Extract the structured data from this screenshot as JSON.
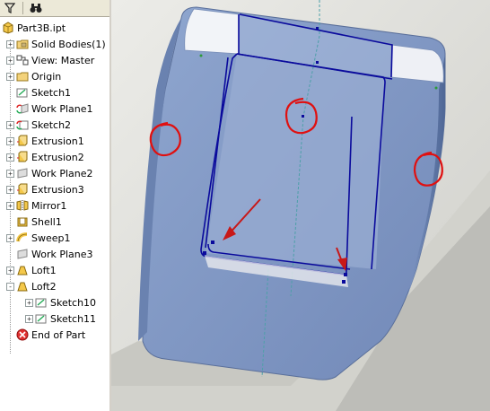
{
  "browser": {
    "toolbar": {
      "filter_icon": "filter-icon",
      "find_icon": "binoculars-icon"
    },
    "root": {
      "label": "Part3B.ipt",
      "icon": "part-icon"
    },
    "items": [
      {
        "label": "Solid Bodies(1)",
        "icon": "folder-solid-icon",
        "expander": "+",
        "indent": 1
      },
      {
        "label": "View: Master",
        "icon": "view-icon",
        "expander": "+",
        "indent": 1
      },
      {
        "label": "Origin",
        "icon": "folder-icon",
        "expander": "+",
        "indent": 1
      },
      {
        "label": "Sketch1",
        "icon": "sketch-icon",
        "expander": "",
        "indent": 1
      },
      {
        "label": "Work Plane1",
        "icon": "workplane-shared-icon",
        "expander": "",
        "indent": 1
      },
      {
        "label": "Sketch2",
        "icon": "sketch-shared-icon",
        "expander": "+",
        "indent": 1
      },
      {
        "label": "Extrusion1",
        "icon": "extrusion-icon",
        "expander": "+",
        "indent": 1
      },
      {
        "label": "Extrusion2",
        "icon": "extrusion-icon",
        "expander": "+",
        "indent": 1
      },
      {
        "label": "Work Plane2",
        "icon": "workplane-icon",
        "expander": "+",
        "indent": 1
      },
      {
        "label": "Extrusion3",
        "icon": "extrusion-icon",
        "expander": "+",
        "indent": 1
      },
      {
        "label": "Mirror1",
        "icon": "mirror-icon",
        "expander": "+",
        "indent": 1
      },
      {
        "label": "Shell1",
        "icon": "shell-icon",
        "expander": "",
        "indent": 1
      },
      {
        "label": "Sweep1",
        "icon": "sweep-icon",
        "expander": "+",
        "indent": 1
      },
      {
        "label": "Work Plane3",
        "icon": "workplane-icon",
        "expander": "",
        "indent": 1
      },
      {
        "label": "Loft1",
        "icon": "loft-icon",
        "expander": "+",
        "indent": 1
      },
      {
        "label": "Loft2",
        "icon": "loft-icon",
        "expander": "-",
        "indent": 1
      },
      {
        "label": "Sketch10",
        "icon": "sketch-icon",
        "expander": "+",
        "indent": 2
      },
      {
        "label": "Sketch11",
        "icon": "sketch-icon",
        "expander": "+",
        "indent": 2
      },
      {
        "label": "End of Part",
        "icon": "end-of-part-icon",
        "expander": "",
        "indent": 1
      }
    ]
  },
  "colors": {
    "model_face": "#7d97c4",
    "model_dark": "#5e78a8",
    "sketch_line": "#0a0a9c",
    "annotation_red": "#e01010",
    "highlight_white": "#f2f4f8"
  }
}
